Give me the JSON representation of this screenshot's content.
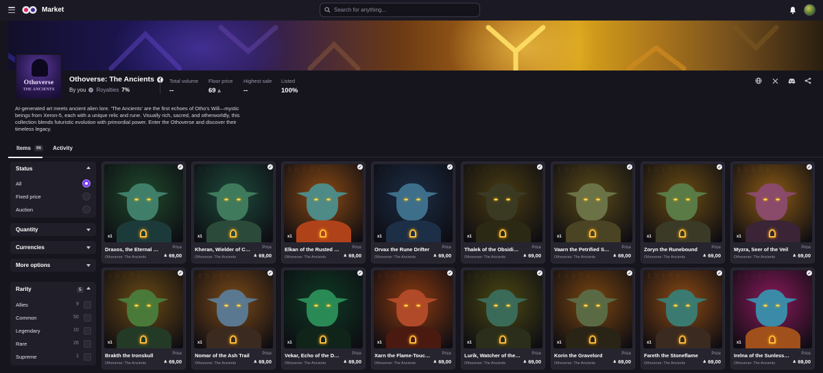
{
  "topbar": {
    "title": "Market",
    "search_placeholder": "Search for anything..."
  },
  "collection": {
    "thumb_title": "Othoverse",
    "thumb_subtitle": "THE ANCIENTS",
    "name": "Othoverse: The Ancients",
    "by_label": "By you",
    "royalties_label": "Royalties",
    "royalties_value": "7%",
    "stats": [
      {
        "label": "Total volume",
        "value": "--"
      },
      {
        "label": "Floor price",
        "value": "69"
      },
      {
        "label": "Highest sale",
        "value": "--"
      },
      {
        "label": "Listed",
        "value": "100%"
      }
    ],
    "description": "AI-generated art meets ancient alien lore. 'The Ancients' are the first echoes of Otho's Will—mystic beings from Xeron-5, each with a unique relic and rune. Visually rich, sacred, and otherworldly, this collection blends futuristic evolution with primordial power. Enter the Othoverse and discover their timeless legacy.",
    "social_icons": [
      "globe-icon",
      "x-icon",
      "discord-icon",
      "share-icon"
    ]
  },
  "tabs": [
    {
      "label": "Items",
      "count": "96"
    },
    {
      "label": "Activity"
    }
  ],
  "filters": {
    "status": {
      "title": "Status",
      "options": [
        "All",
        "Fixed price",
        "Auction"
      ],
      "selected": "All"
    },
    "quantity": "Quantity",
    "currencies": "Currencies",
    "more_options": "More options",
    "rarity": {
      "title": "Rarity",
      "count": "5",
      "items": [
        {
          "label": "Allies",
          "count": "9"
        },
        {
          "label": "Common",
          "count": "50"
        },
        {
          "label": "Legendary",
          "count": "10"
        },
        {
          "label": "Rare",
          "count": "26"
        },
        {
          "label": "Supreme",
          "count": "1"
        }
      ]
    }
  },
  "card_common": {
    "quantity": "x1",
    "collection": "Othoverse: The Ancients",
    "price_label": "Price",
    "price": "69,00"
  },
  "items": [
    {
      "name": "Draxos, the Eternal Watcher",
      "bg": "#1f4a2c",
      "skin": "#3f7f6a",
      "robe": "#1d3a3a"
    },
    {
      "name": "Kheran, Wielder of Crystals",
      "bg": "#1d4a3a",
      "skin": "#3f7a5c",
      "robe": "#2c4a3a"
    },
    {
      "name": "Elkan of the Rusted Crown",
      "bg": "#8a4a14",
      "skin": "#4e8a86",
      "robe": "#b0421a"
    },
    {
      "name": "Orvax the Rune Drifter",
      "bg": "#1c2d44",
      "skin": "#3d6f8a",
      "robe": "#1c2f46"
    },
    {
      "name": "Thalek of the Obsidian Blade",
      "bg": "#4a3c12",
      "skin": "#3a3a22",
      "robe": "#2b2814"
    },
    {
      "name": "Vaarn the Petrified Sage",
      "bg": "#5a4a18",
      "skin": "#6a7246",
      "robe": "#4a4424"
    },
    {
      "name": "Zoryn the Runebound",
      "bg": "#6a4c12",
      "skin": "#5a7a46",
      "robe": "#3a3a26"
    },
    {
      "name": "Myzra, Seer of the Veil",
      "bg": "#8a5a14",
      "skin": "#8a4a6a",
      "robe": "#3a2436"
    },
    {
      "name": "Brakth the Ironskull",
      "bg": "#6a4a14",
      "skin": "#4a7a3a",
      "robe": "#233a26"
    },
    {
      "name": "Nomar of the Ash Trail",
      "bg": "#7a4a18",
      "skin": "#5a7890",
      "robe": "#3a2a20"
    },
    {
      "name": "Vekar, Echo of the Dust",
      "bg": "#0e3a24",
      "skin": "#2a8a56",
      "robe": "#10241a"
    },
    {
      "name": "Xarn the Flame-Touched",
      "bg": "#8a3a10",
      "skin": "#b04a28",
      "robe": "#4a1a10"
    },
    {
      "name": "Lurik, Watcher of the Spire",
      "bg": "#4a4812",
      "skin": "#3a6a58",
      "robe": "#2a2e1a"
    },
    {
      "name": "Korin the Gravelord",
      "bg": "#7a4610",
      "skin": "#5a6a44",
      "robe": "#2a2416"
    },
    {
      "name": "Fareth the Stoneflame",
      "bg": "#8a4a14",
      "skin": "#3a7a70",
      "robe": "#3a2a20"
    },
    {
      "name": "Irelna of the Sunless Realm",
      "bg": "#8a1a5a",
      "skin": "#3a8aa8",
      "robe": "#a0501a"
    }
  ]
}
